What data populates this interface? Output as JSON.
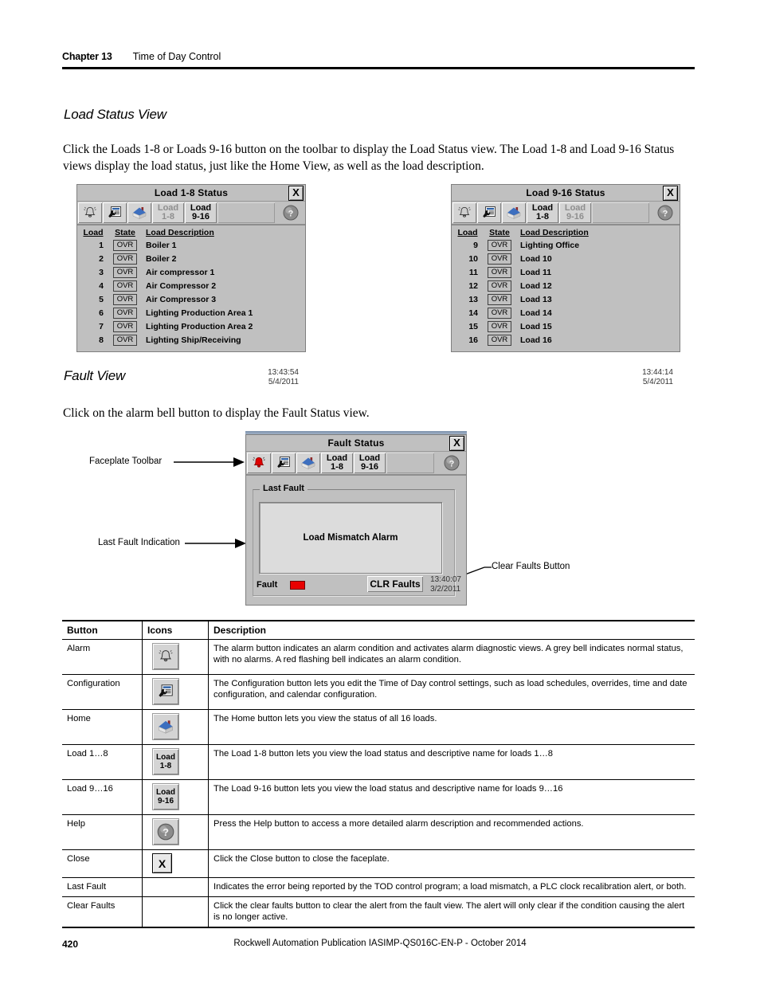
{
  "header": {
    "chapter_label": "Chapter 13",
    "chapter_title": "Time of Day Control"
  },
  "sections": {
    "load_status_heading": "Load Status View",
    "load_status_paragraph": "Click the Loads 1-8 or Loads 9-16 button on the toolbar to display the Load Status view. The Load 1-8 and Load 9-16 Status views display the load status, just like the Home View, as well as the load description.",
    "fault_view_heading": "Fault View",
    "fault_view_paragraph": "Click on the alarm bell button to display the Fault Status view."
  },
  "faceplate_load_1_8": {
    "title": "Load 1-8 Status",
    "close_label": "X",
    "toolbar": {
      "alarm_icon": "alarm-bell-icon",
      "config_icon": "configuration-wrench-icon",
      "home_icon": "home-icon",
      "load_1_8_line1": "Load",
      "load_1_8_line2": "1-8",
      "load_1_8_state": "inactive",
      "load_9_16_line1": "Load",
      "load_9_16_line2": "9-16",
      "load_9_16_state": "active",
      "help_icon": "help-question-icon"
    },
    "columns": [
      "Load",
      "State",
      "Load Description"
    ],
    "rows": [
      {
        "load": "1",
        "state": "OVR",
        "description": "Boiler 1"
      },
      {
        "load": "2",
        "state": "OVR",
        "description": "Boiler 2"
      },
      {
        "load": "3",
        "state": "OVR",
        "description": "Air compressor 1"
      },
      {
        "load": "4",
        "state": "OVR",
        "description": "Air Compressor 2"
      },
      {
        "load": "5",
        "state": "OVR",
        "description": "Air Compressor 3"
      },
      {
        "load": "6",
        "state": "OVR",
        "description": "Lighting Production Area 1"
      },
      {
        "load": "7",
        "state": "OVR",
        "description": "Lighting Production Area 2"
      },
      {
        "load": "8",
        "state": "OVR",
        "description": "Lighting Ship/Receiving"
      }
    ],
    "time": "13:43:54",
    "date": "5/4/2011"
  },
  "faceplate_load_9_16": {
    "title": "Load 9-16 Status",
    "close_label": "X",
    "toolbar": {
      "load_1_8_line1": "Load",
      "load_1_8_line2": "1-8",
      "load_1_8_state": "active",
      "load_9_16_line1": "Load",
      "load_9_16_line2": "9-16",
      "load_9_16_state": "inactive"
    },
    "columns": [
      "Load",
      "State",
      "Load Description"
    ],
    "rows": [
      {
        "load": "9",
        "state": "OVR",
        "description": "Lighting Office"
      },
      {
        "load": "10",
        "state": "OVR",
        "description": "Load 10"
      },
      {
        "load": "11",
        "state": "OVR",
        "description": "Load 11"
      },
      {
        "load": "12",
        "state": "OVR",
        "description": "Load 12"
      },
      {
        "load": "13",
        "state": "OVR",
        "description": "Load 13"
      },
      {
        "load": "14",
        "state": "OVR",
        "description": "Load 14"
      },
      {
        "load": "15",
        "state": "OVR",
        "description": "Load 15"
      },
      {
        "load": "16",
        "state": "OVR",
        "description": "Load 16"
      }
    ],
    "time": "13:44:14",
    "date": "5/4/2011"
  },
  "faceplate_fault": {
    "title": "Fault Status",
    "close_label": "X",
    "toolbar": {
      "alarm_icon": "alarm-bell-icon",
      "alarm_color": "#e00000",
      "load_1_8_line1": "Load",
      "load_1_8_line2": "1-8",
      "load_9_16_line1": "Load",
      "load_9_16_line2": "9-16"
    },
    "group_legend": "Last Fault",
    "fault_message": "Load Mismatch Alarm",
    "fault_label": "Fault",
    "fault_led_color": "#e80000",
    "clear_button": "CLR Faults",
    "time": "13:40:07",
    "date": "3/2/2011"
  },
  "annotations": {
    "faceplate_toolbar": "Faceplate Toolbar",
    "last_fault_indication": "Last Fault Indication",
    "clear_faults_button": "Clear Faults Button"
  },
  "reference_table": {
    "headers": [
      "Button",
      "Icons",
      "Description"
    ],
    "rows": [
      {
        "button": "Alarm",
        "icon": "alarm-bell-icon",
        "description": "The alarm button indicates an alarm condition and activates alarm diagnostic views. A grey bell indicates normal status, with no alarms. A red flashing bell indicates an alarm condition."
      },
      {
        "button": "Configuration",
        "icon": "configuration-wrench-icon",
        "description": "The Configuration button lets you edit the Time of Day control settings, such as load schedules, overrides, time and date configuration, and calendar configuration."
      },
      {
        "button": "Home",
        "icon": "home-icon",
        "description": "The Home button lets you view the status of all 16 loads."
      },
      {
        "button": "Load 1…8",
        "icon": "load-1-8-icon",
        "icon_line1": "Load",
        "icon_line2": "1-8",
        "description": "The Load 1-8 button lets you view the load status and descriptive name for loads 1…8"
      },
      {
        "button": "Load 9…16",
        "icon": "load-9-16-icon",
        "icon_line1": "Load",
        "icon_line2": "9-16",
        "description": "The Load 9-16 button lets you view the load status and descriptive name for loads 9…16"
      },
      {
        "button": "Help",
        "icon": "help-question-icon",
        "description": "Press the Help button to access a more detailed alarm description and recommended actions."
      },
      {
        "button": "Close",
        "icon": "close-x-icon",
        "icon_text": "X",
        "description": "Click the Close button to close the faceplate."
      },
      {
        "button": "Last Fault",
        "icon": "",
        "description": "Indicates the error being reported by the TOD control program; a load mismatch, a PLC clock recalibration alert, or both."
      },
      {
        "button": "Clear Faults",
        "icon": "",
        "description": "Click the clear faults button to clear the alert from the fault view. The alert will only clear if the condition causing the alert is no longer active."
      }
    ]
  },
  "footer": {
    "page_number": "420",
    "publication": "Rockwell Automation Publication IASIMP-QS016C-EN-P - October 2014"
  }
}
